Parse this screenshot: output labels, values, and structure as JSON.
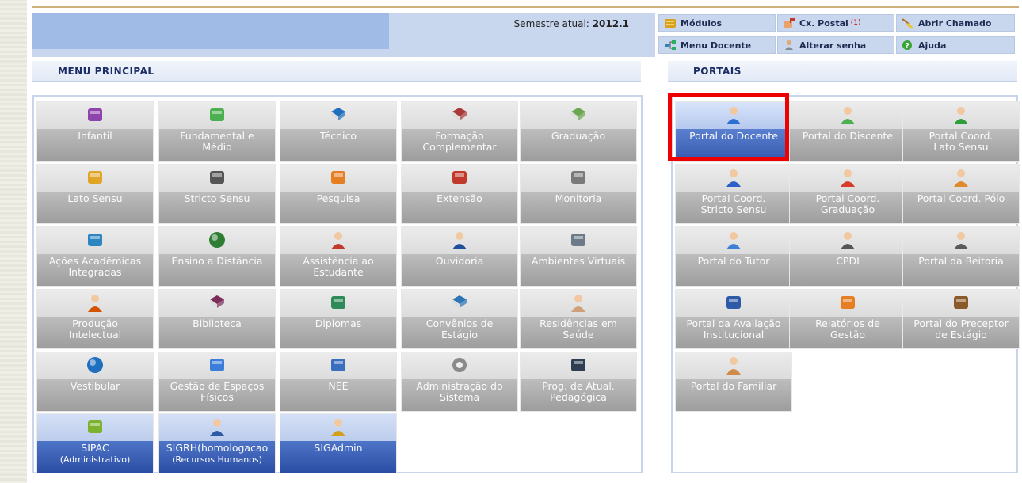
{
  "header": {
    "semester_label": "Semestre atual:",
    "semester_value": "2012.1",
    "buttons": [
      {
        "label": "Módulos",
        "icon": "modules-icon"
      },
      {
        "label": "Cx. Postal",
        "badge": "(1)",
        "icon": "mailbox-icon"
      },
      {
        "label": "Abrir Chamado",
        "icon": "broom-icon"
      },
      {
        "label": "Menu Docente",
        "icon": "menu-tree-icon"
      },
      {
        "label": "Alterar senha",
        "icon": "user-key-icon"
      },
      {
        "label": "Ajuda",
        "icon": "help-icon"
      }
    ]
  },
  "menu_principal": {
    "title": "MENU PRINCIPAL",
    "items": [
      {
        "label": "Infantil",
        "icon": "pencil-cup-icon"
      },
      {
        "label": "Fundamental e\nMédio",
        "icon": "crayon-icon"
      },
      {
        "label": "Técnico",
        "icon": "blue-book-icon"
      },
      {
        "label": "Formação\nComplementar",
        "icon": "red-book-icon"
      },
      {
        "label": "Graduação",
        "icon": "book-stack-icon"
      },
      {
        "label": "Lato Sensu",
        "icon": "folder-icon"
      },
      {
        "label": "Stricto Sensu",
        "icon": "briefcase-icon"
      },
      {
        "label": "Pesquisa",
        "icon": "flask-icon"
      },
      {
        "label": "Extensão",
        "icon": "house-icon"
      },
      {
        "label": "Monitoria",
        "icon": "presentation-board-icon"
      },
      {
        "label": "Ações Acadêmicas\nIntegradas",
        "icon": "puzzle-icon"
      },
      {
        "label": "Ensino a Distância",
        "icon": "globe-icon"
      },
      {
        "label": "Assistência ao\nEstudante",
        "icon": "student-help-icon"
      },
      {
        "label": "Ouvidoria",
        "icon": "headset-user-icon"
      },
      {
        "label": "Ambientes Virtuais",
        "icon": "group-icon"
      },
      {
        "label": "Produção\nIntelectual",
        "icon": "user-check-icon"
      },
      {
        "label": "Biblioteca",
        "icon": "open-book-icon"
      },
      {
        "label": "Diplomas",
        "icon": "certificate-icon"
      },
      {
        "label": "Convênios de\nEstágio",
        "icon": "address-book-icon"
      },
      {
        "label": "Residências em\nSaúde",
        "icon": "doctor-icon"
      },
      {
        "label": "Vestibular",
        "icon": "spiral-logo-icon"
      },
      {
        "label": "Gestão de Espaços\nFísicos",
        "icon": "building-network-icon"
      },
      {
        "label": "NEE",
        "icon": "accessibility-icon"
      },
      {
        "label": "Administração do\nSistema",
        "icon": "gear-icon"
      },
      {
        "label": "Prog. de Atual.\nPedagógica",
        "icon": "video-conference-icon"
      }
    ],
    "system_items": [
      {
        "label": "SIPAC",
        "sub": "(Administrativo)",
        "icon": "coins-icon"
      },
      {
        "label": "SIGRH(homologacao",
        "sub": "(Recursos Humanos)",
        "icon": "user-icon"
      },
      {
        "label": "SIGAdmin",
        "sub": "",
        "icon": "admin-user-icon"
      }
    ]
  },
  "portais": {
    "title": "PORTAIS",
    "items": [
      {
        "label": "Portal do Docente",
        "icon": "teacher-icon"
      },
      {
        "label": "Portal do Discente",
        "icon": "student-icon"
      },
      {
        "label": "Portal Coord.\nLato Sensu",
        "icon": "green-pawn-icon"
      },
      {
        "label": "Portal Coord.\nStricto Sensu",
        "icon": "blue-pawn-icon"
      },
      {
        "label": "Portal Coord.\nGraduação",
        "icon": "red-pawn-icon"
      },
      {
        "label": "Portal Coord. Pólo",
        "icon": "coordinator-icon"
      },
      {
        "label": "Portal do Tutor",
        "icon": "tutor-icon"
      },
      {
        "label": "CPDI",
        "icon": "suit-user-icon"
      },
      {
        "label": "Portal da Reitoria",
        "icon": "executive-icon"
      },
      {
        "label": "Portal da Avaliação\nInstitucional",
        "icon": "checklist-doc-icon"
      },
      {
        "label": "Relatórios de\nGestão",
        "icon": "report-chart-icon"
      },
      {
        "label": "Portal do Preceptor\nde Estágio",
        "icon": "id-card-icon"
      },
      {
        "label": "Portal do Familiar",
        "icon": "family-icon"
      }
    ]
  }
}
